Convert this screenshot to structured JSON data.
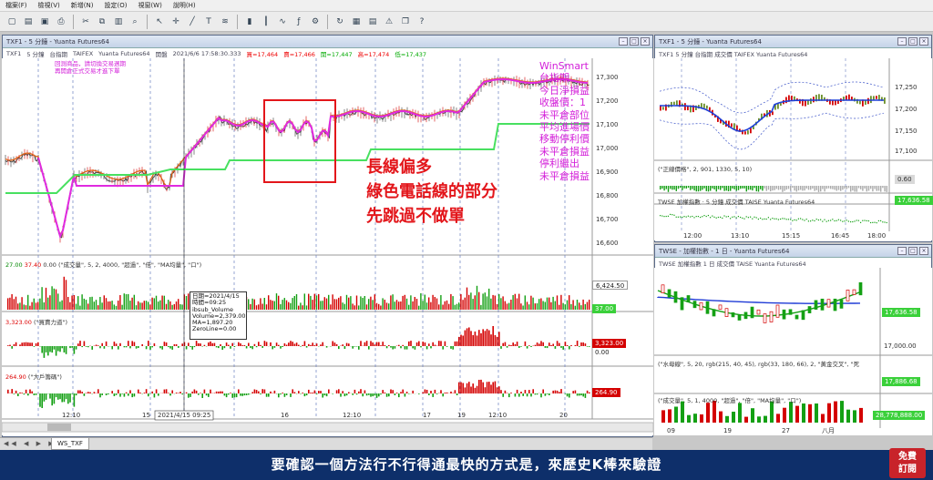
{
  "menu": [
    "檔案(F)",
    "檢視(V)",
    "新增(N)",
    "設定(O)",
    "視窗(W)",
    "說明(H)"
  ],
  "toolbar_icons": [
    "new-icon",
    "open-icon",
    "save-icon",
    "print-icon",
    "cut-icon",
    "copy-icon",
    "paste-icon",
    "zoom-icon",
    "pointer-icon",
    "crosshair-icon",
    "line-icon",
    "text-icon",
    "fib-icon",
    "bar-chart-icon",
    "candle-icon",
    "line-chart-icon",
    "indicator-icon",
    "settings-icon",
    "refresh-icon",
    "grid-icon",
    "table-icon",
    "alert-icon",
    "window-icon",
    "help-icon"
  ],
  "main": {
    "title": "TXF1 - 5 分鐘 - Yuanta Futures64",
    "info": {
      "sym": "TXF1",
      "period": "5 分鐘",
      "product": "台指期",
      "exchange": "TAIFEX",
      "vendor": "Yuanta Futures64",
      "session": "開盤",
      "datetime": "2021/6/6  17:58:30.333",
      "buy": "買=17,464",
      "sell": "賣=17,466",
      "open": "開=17,447",
      "high": "高=17,474",
      "low": "低=17,437"
    },
    "note_lines": [
      "回測商品，請切換交易週期",
      "再開倉正式交易才進下單"
    ],
    "pink_panel": [
      "WinSmart",
      "台指期",
      "今日淨損益",
      "收盤價：1",
      "未平倉部位",
      "平均進場價",
      "移動停利價",
      "未平倉損益",
      "停利繼出",
      "未平倉損益"
    ],
    "price_ticks": [
      "17,300",
      "17,200",
      "17,100",
      "17,000",
      "16,900",
      "16,800",
      "16,700",
      "16,600"
    ],
    "annotation": [
      "長線偏多",
      "綠色電話線的部分",
      "先跳過不做單"
    ],
    "vol_label": {
      "a": "27.00",
      "b": "37.40",
      "c": "0.00",
      "text": "(\"成交量\", 5, 2, 4000, \"超過\", \"倍\", \"MA均量\", \"口\")"
    },
    "vol_tags": [
      "6,424.50",
      "37.00"
    ],
    "buysell_label": {
      "a": "3,323.00",
      "text": "(\"買賣力道\")"
    },
    "buysell_tags": [
      "3,323.00",
      "0.00"
    ],
    "bigplayer_label": {
      "a": "264.90",
      "text": "(\"大戶籌碼\")"
    },
    "bigplayer_tags": [
      "264.90"
    ],
    "tooltip": [
      "日期=2021/4/15",
      "時間=09:25",
      "ibsub_Volume",
      "Volume=2,379.00",
      "MA=1,897.20",
      "ZeroLine=0.00"
    ],
    "x_ticks": [
      "12:10",
      "15",
      "2021/4/15 09:25",
      "16",
      "12:10",
      "17",
      "19",
      "12:10",
      "20"
    ]
  },
  "right_top": {
    "title": "TXF1 - 5 分鐘 - Yuanta Futures64",
    "info": "TXF1  5 分鐘  台指期  成交價  TAIFEX  Yuanta Futures64",
    "price_ticks": [
      "17,250",
      "17,200",
      "17,150",
      "17,100"
    ],
    "ind1": "(\"正線價格\", 2, 901, 1330, 5, 10)",
    "ind1_tag": "0.60",
    "ind2": "TWSE  加權指數 · 5 分鐘  成交價  TAISE  Yuanta Futures64",
    "ind2_tag": "17,636.58",
    "x_ticks": [
      "12:00",
      "13:10",
      "15:15",
      "16:45",
      "18:00"
    ]
  },
  "right_bottom": {
    "title": "TWSE - 加權指數 - 1 日 - Yuanta Futures64",
    "info": "TWSE  加權指數  1 日  成交價  TAISE  Yuanta Futures64",
    "price_ticks": [
      "17,000.00"
    ],
    "price_tag": "17,636.58",
    "ind1": "(\"水母線\", 5, 20, rgb(215, 40, 45), rgb(33, 180, 66), 2, \"黃金交叉\", \"死",
    "ind1_tag": "17,886.68",
    "ind2": "(\"成交量\", 5, 1, 4000, \"超過\", \"倍\", \"MA均量\", \"口\")",
    "ind2_tag": "28,778,888.00",
    "x_ticks": [
      "09",
      "19",
      "27",
      "八月"
    ]
  },
  "tab": "WS_TXF",
  "subtitle": "要確認一個方法行不行得通最快的方式是，來歷史K棒來驗證",
  "subscribe": [
    "免費",
    "訂閱"
  ],
  "colors": {
    "annotation": "#e3161b",
    "pink": "#d31fd9",
    "orange": "#e06010",
    "green_line": "#48e060",
    "banner": "#0e2f6a",
    "up": "#d40000",
    "down": "#14a014"
  }
}
